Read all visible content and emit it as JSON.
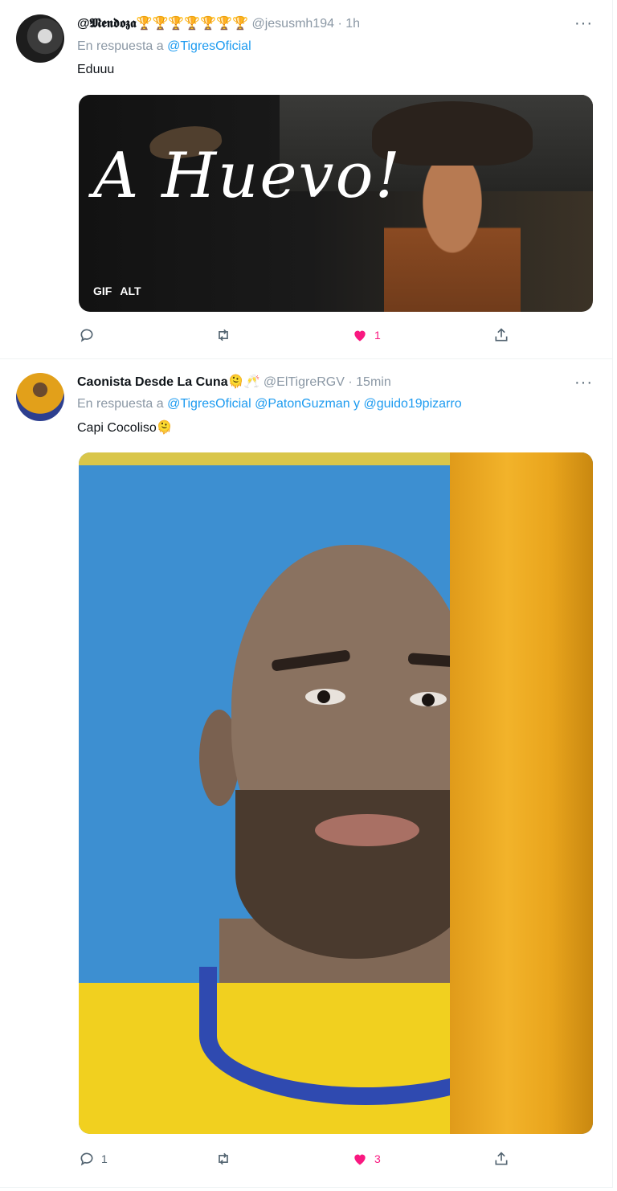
{
  "tweets": [
    {
      "author_name": "@𝕸𝖊𝖓𝖉𝖔𝖟𝖆",
      "author_emoji": "🏆🏆🏆🏆🏆🏆🏆",
      "handle": "@jesusmh194",
      "time": "1h",
      "replying_prefix": "En respuesta a",
      "replying_to": "@TigresOficial",
      "text": "Eduuu",
      "media": {
        "overlay_text": "A Huevo!",
        "badges": [
          "GIF",
          "ALT"
        ]
      },
      "stats": {
        "replies": "",
        "retweets": "",
        "likes": "1"
      }
    },
    {
      "author_name": "Caonista Desde La Cuna",
      "author_emoji": "🫠🥂",
      "handle": "@ElTigreRGV",
      "time": "15min",
      "replying_prefix": "En respuesta a",
      "replying_to": "@TigresOficial @PatonGuzman y @guido19pizarro",
      "text": "Capi Cocoliso🫠",
      "stats": {
        "replies": "1",
        "retweets": "",
        "likes": "3"
      }
    }
  ],
  "ui": {
    "dot": "·",
    "more": "···"
  },
  "colors": {
    "accent": "#1d9bf0",
    "like": "#f91880",
    "muted": "#8b98a5"
  }
}
